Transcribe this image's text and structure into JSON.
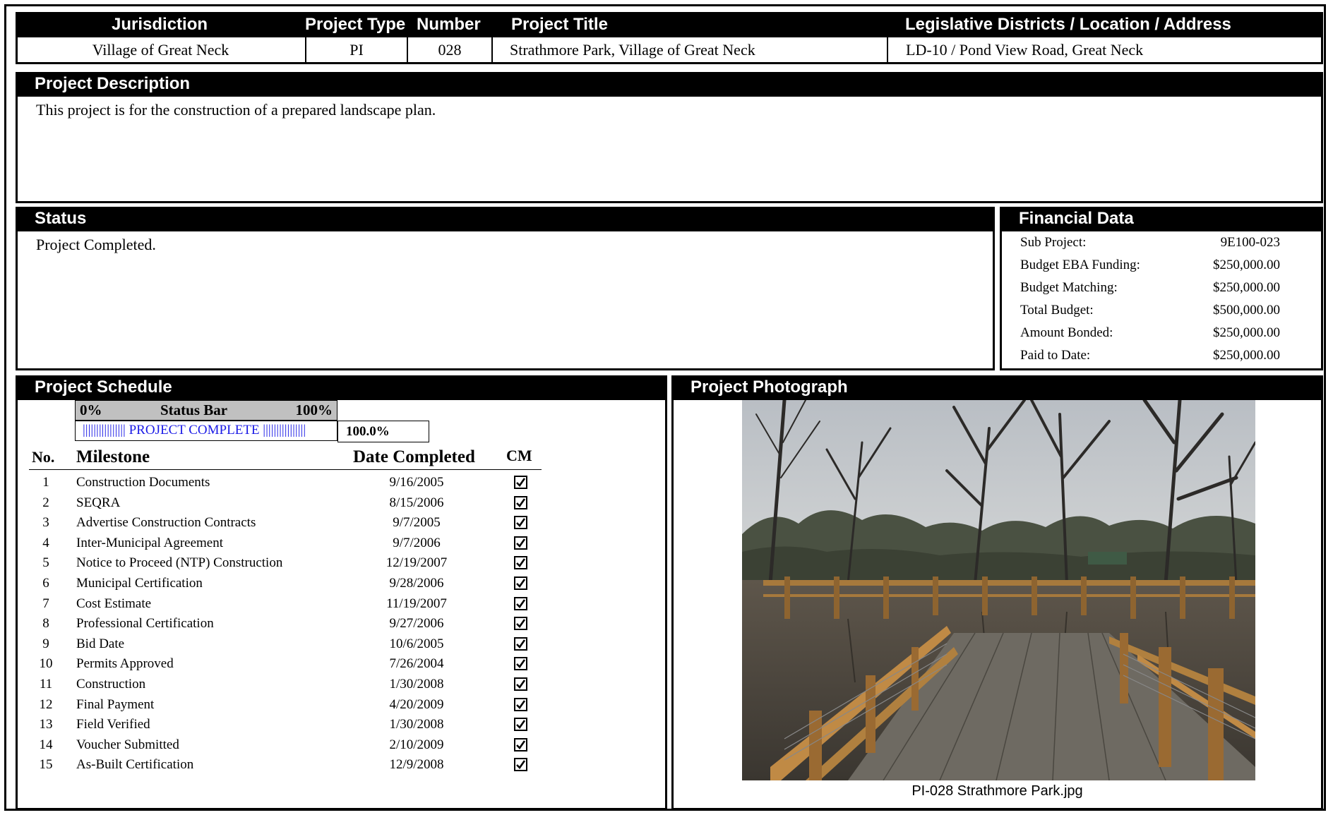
{
  "header": {
    "columns": [
      "Jurisdiction",
      "Project Type",
      "Number",
      "Project Title",
      "Legislative Districts / Location / Address"
    ],
    "jurisdiction": "Village of Great Neck",
    "project_type": "PI",
    "number": "028",
    "project_title": "Strathmore Park, Village of Great Neck",
    "location": "LD-10 / Pond View Road, Great Neck"
  },
  "description": {
    "title": "Project Description",
    "text": "This project is for the construction of a prepared landscape plan."
  },
  "status": {
    "title": "Status",
    "text": "Project Completed."
  },
  "financial": {
    "title": "Financial Data",
    "rows": [
      {
        "label": "Sub Project:",
        "value": "9E100-023"
      },
      {
        "label": "Budget EBA Funding:",
        "value": "$250,000.00"
      },
      {
        "label": "Budget Matching:",
        "value": "$250,000.00"
      },
      {
        "label": "Total Budget:",
        "value": "$500,000.00"
      },
      {
        "label": "Amount Bonded:",
        "value": "$250,000.00"
      },
      {
        "label": "Paid to Date:",
        "value": "$250,000.00"
      }
    ]
  },
  "schedule": {
    "title": "Project Schedule",
    "statusbar": {
      "left": "0%",
      "label": "Status Bar",
      "right": "100%",
      "fill_text": "|||||||||||||||| PROJECT COMPLETE ||||||||||||||||",
      "percent_text": "100.0%",
      "progress": 1.0
    },
    "columns": {
      "no": "No.",
      "milestone": "Milestone",
      "date": "Date Completed",
      "cm": "CM"
    },
    "milestones": [
      {
        "no": "1",
        "name": "Construction Documents",
        "date": "9/16/2005",
        "cm": true
      },
      {
        "no": "2",
        "name": "SEQRA",
        "date": "8/15/2006",
        "cm": true
      },
      {
        "no": "3",
        "name": "Advertise Construction Contracts",
        "date": "9/7/2005",
        "cm": true
      },
      {
        "no": "4",
        "name": "Inter-Municipal Agreement",
        "date": "9/7/2006",
        "cm": true
      },
      {
        "no": "5",
        "name": "Notice to Proceed (NTP) Construction",
        "date": "12/19/2007",
        "cm": true
      },
      {
        "no": "6",
        "name": "Municipal Certification",
        "date": "9/28/2006",
        "cm": true
      },
      {
        "no": "7",
        "name": "Cost Estimate",
        "date": "11/19/2007",
        "cm": true
      },
      {
        "no": "8",
        "name": "Professional Certification",
        "date": "9/27/2006",
        "cm": true
      },
      {
        "no": "9",
        "name": "Bid Date",
        "date": "10/6/2005",
        "cm": true
      },
      {
        "no": "10",
        "name": "Permits Approved",
        "date": "7/26/2004",
        "cm": true
      },
      {
        "no": "11",
        "name": "Construction",
        "date": "1/30/2008",
        "cm": true
      },
      {
        "no": "12",
        "name": "Final Payment",
        "date": "4/20/2009",
        "cm": true
      },
      {
        "no": "13",
        "name": "Field Verified",
        "date": "1/30/2008",
        "cm": true
      },
      {
        "no": "14",
        "name": "Voucher Submitted",
        "date": "2/10/2009",
        "cm": true
      },
      {
        "no": "15",
        "name": "As-Built Certification",
        "date": "12/9/2008",
        "cm": true
      }
    ]
  },
  "photo": {
    "title": "Project Photograph",
    "caption": "PI-028 Strathmore Park.jpg"
  }
}
